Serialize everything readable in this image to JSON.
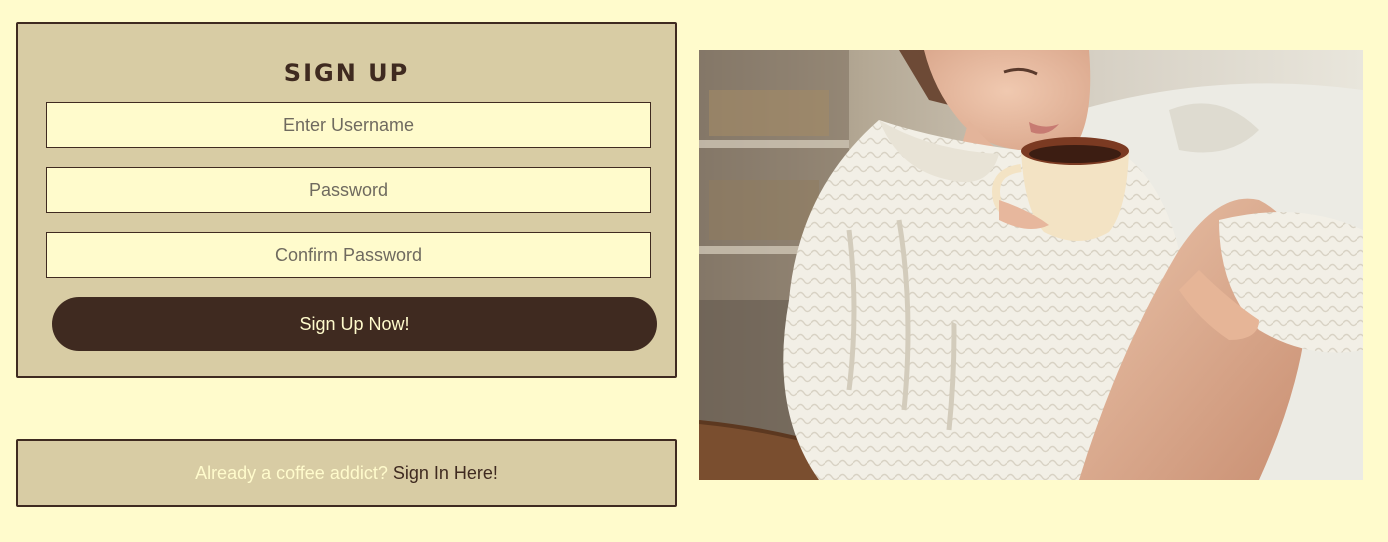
{
  "signup": {
    "title": "SIGN UP",
    "username_placeholder": "Enter Username",
    "password_placeholder": "Password",
    "confirm_placeholder": "Confirm Password",
    "submit_label": "Sign Up Now!"
  },
  "signin": {
    "prompt": "Already a coffee addict?",
    "link_label": "Sign In Here!"
  },
  "colors": {
    "background": "#fffbcc",
    "card": "#d8cca4",
    "accent": "#3f2a20"
  },
  "photo": {
    "icon": "coffee-photo"
  }
}
